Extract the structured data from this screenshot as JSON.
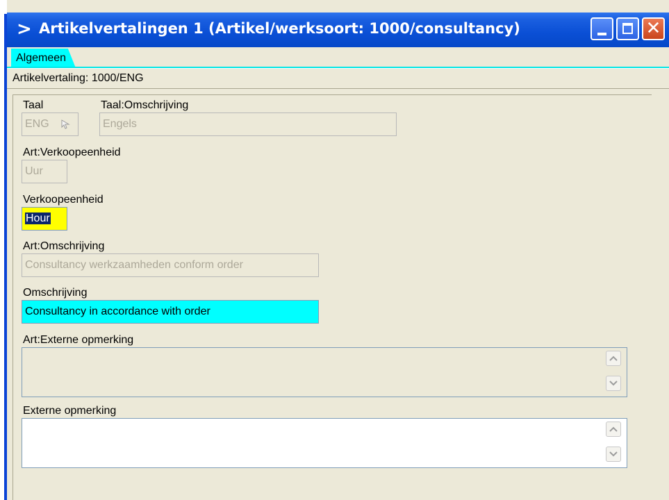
{
  "window": {
    "title": "Artikelvertalingen 1 (Artikel/werksoort: 1000/consultancy)",
    "controls": [
      "minimize",
      "maximize",
      "close"
    ]
  },
  "tabs": [
    {
      "label": "Algemeen",
      "active": true
    }
  ],
  "subheader": "Artikelvertaling: 1000/ENG",
  "form": {
    "taal": {
      "label": "Taal",
      "value": "ENG"
    },
    "taal_omschrijving": {
      "label": "Taal:Omschrijving",
      "value": "Engels"
    },
    "art_verkoopeenheid": {
      "label": "Art:Verkoopeenheid",
      "value": "Uur"
    },
    "verkoopeenheid": {
      "label": "Verkoopeenheid",
      "value": "Hour"
    },
    "art_omschrijving": {
      "label": "Art:Omschrijving",
      "value": "Consultancy werkzaamheden conform order"
    },
    "omschrijving": {
      "label": "Omschrijving",
      "value": "Consultancy in accordance with order"
    },
    "art_externe_opmerking": {
      "label": "Art:Externe opmerking",
      "value": ""
    },
    "externe_opmerking": {
      "label": "Externe opmerking",
      "value": ""
    }
  },
  "icons": {
    "title": "app-logo-icon",
    "lookup": "lookup-arrow-icon",
    "scroll_up": "scroll-up-icon",
    "scroll_down": "scroll-down-icon"
  },
  "colors": {
    "titlebar": "#0a4fd5",
    "tab_active": "#00ffff",
    "field_focus": "#ffff00",
    "field_highlight": "#00ffff",
    "window_bg": "#ece9d8"
  }
}
